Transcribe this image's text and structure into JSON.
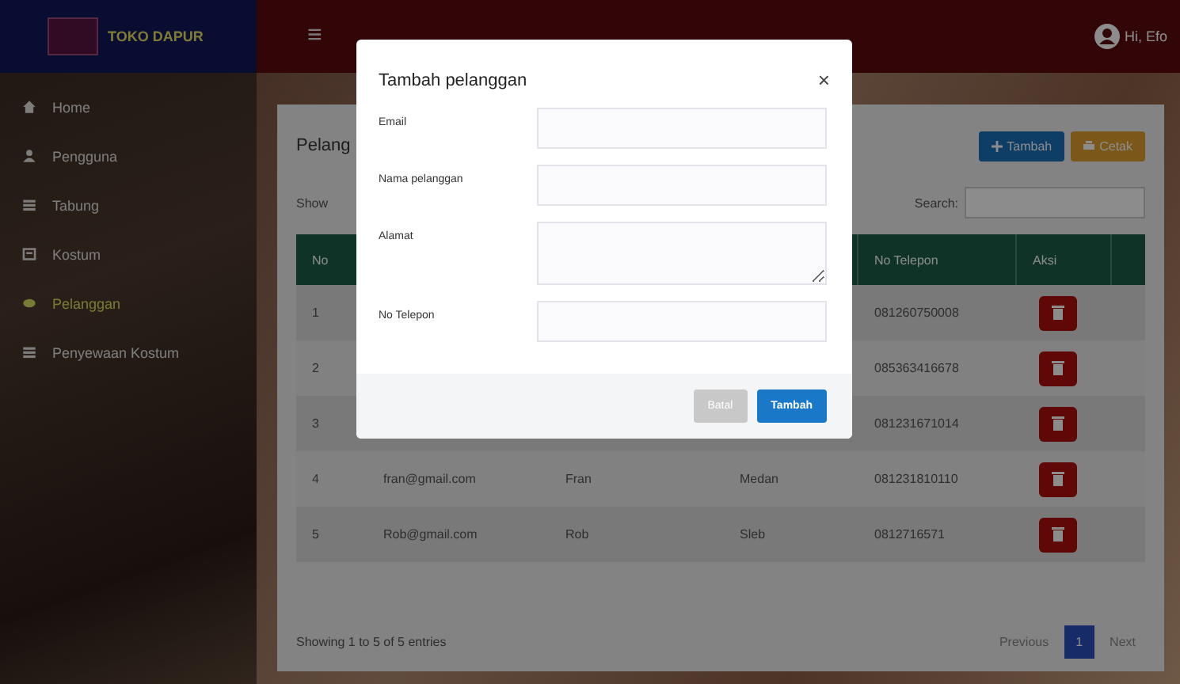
{
  "brand": {
    "name": "TOKO DAPUR"
  },
  "sidebar": {
    "items": [
      {
        "label": "Home",
        "kind": "home",
        "selected": false
      },
      {
        "label": "Pengguna",
        "kind": "user",
        "selected": false
      },
      {
        "label": "Tabung",
        "kind": "list",
        "selected": false
      },
      {
        "label": "Kostum",
        "kind": "box",
        "selected": false
      },
      {
        "label": "Pelanggan",
        "kind": "circle",
        "selected": true
      },
      {
        "label": "Penyewaan Kostum",
        "kind": "list",
        "selected": false
      }
    ]
  },
  "header": {
    "menu_icon": "≡",
    "user": "Hi, Efo"
  },
  "card": {
    "title": "Pelang",
    "buttons": [
      {
        "kind": "add",
        "label": "Tambah"
      },
      {
        "kind": "print",
        "label": "Cetak"
      }
    ],
    "show_label": "Show",
    "search_label": "Search:",
    "table": {
      "header": {
        "no": "No",
        "phone": "No Telepon",
        "action": "Aksi"
      },
      "rows": [
        {
          "no": "1",
          "phone": "081260750008"
        },
        {
          "no": "2",
          "phone": "085363416678"
        },
        {
          "no": "3",
          "phone": "081231671014"
        },
        {
          "no": "4",
          "email": "fran@gmail.com",
          "name": "Fran",
          "address": "Medan",
          "phone": "081231810110"
        },
        {
          "no": "5",
          "email": "Rob@gmail.com",
          "name": "Rob",
          "address": "Sleb",
          "phone": "0812716571"
        }
      ]
    },
    "info": "Showing 1 to 5 of 5 entries",
    "pagination": [
      {
        "label": "Previous",
        "kind": "nav",
        "selected": false
      },
      {
        "label": "1",
        "kind": "page",
        "selected": true
      },
      {
        "label": "Next",
        "kind": "nav",
        "selected": false
      }
    ]
  },
  "modal": {
    "title": "Tambah pelanggan",
    "close": "×",
    "fields": [
      {
        "label": "Email",
        "kind": "input"
      },
      {
        "label": "Nama pelanggan",
        "kind": "input"
      },
      {
        "label": "Alamat",
        "kind": "textarea"
      },
      {
        "label": "No Telepon",
        "kind": "input"
      }
    ],
    "buttons": [
      {
        "label": "Batal",
        "kind": "secondary"
      },
      {
        "label": "Tambah",
        "kind": "primary"
      }
    ]
  }
}
